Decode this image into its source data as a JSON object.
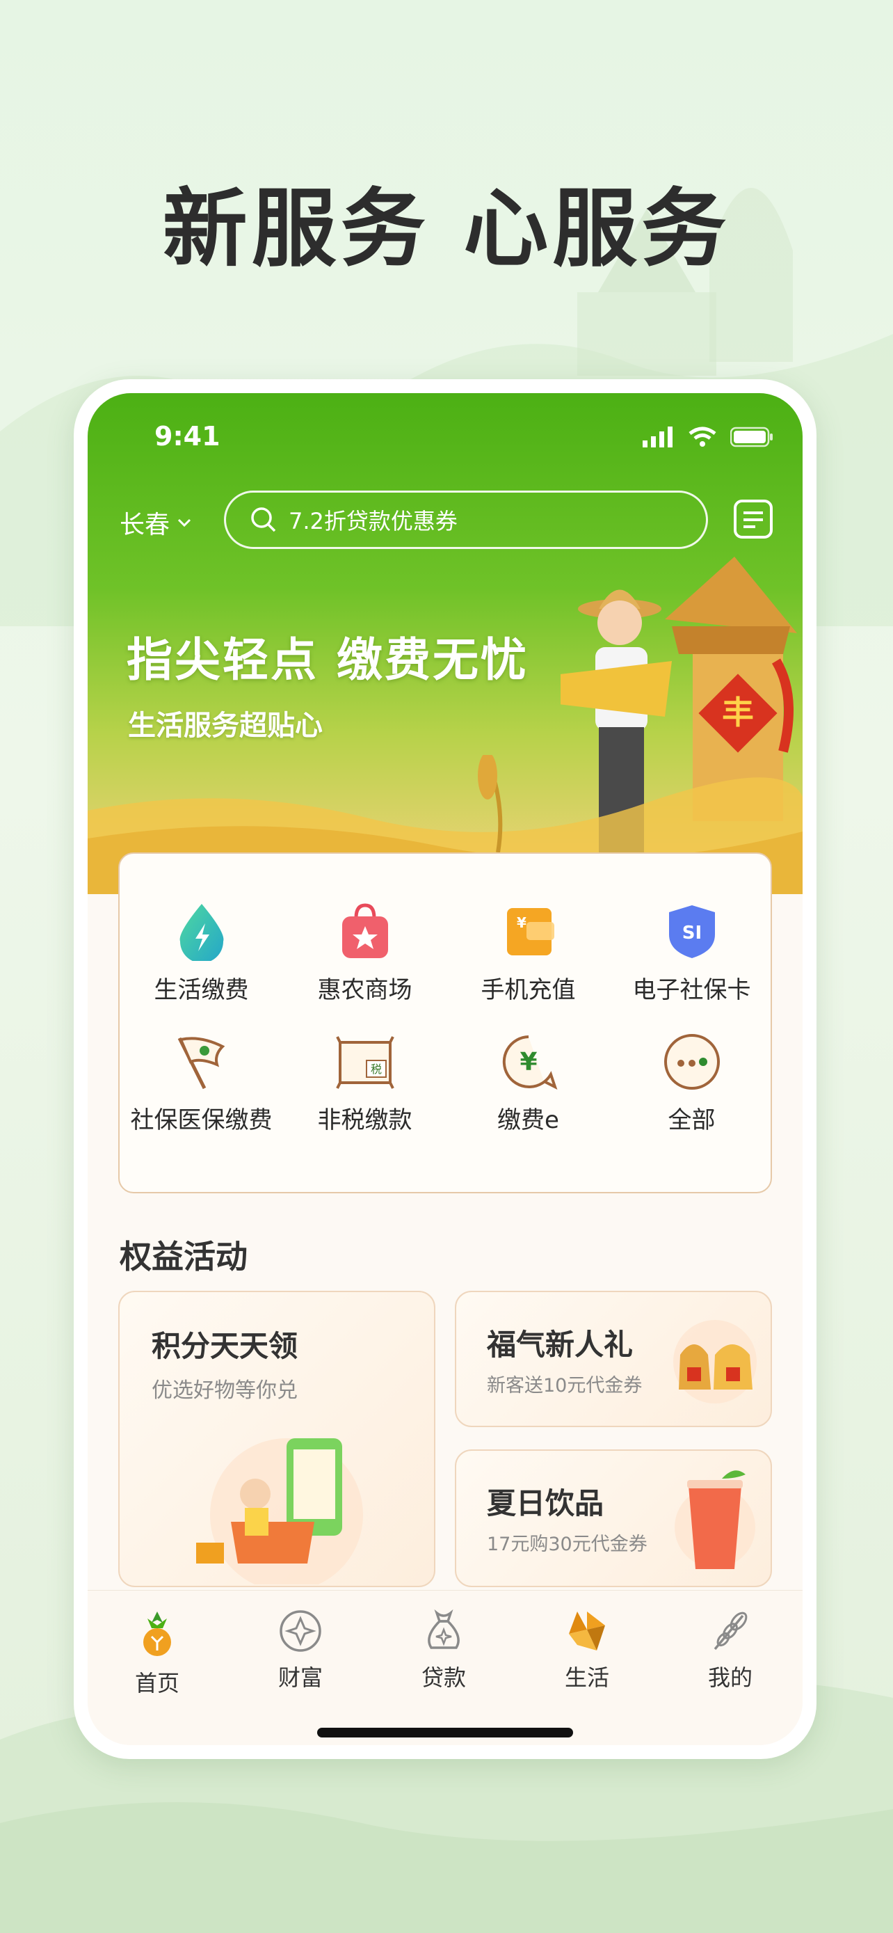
{
  "headline": "新服务 心服务",
  "status_bar": {
    "time": "9:41"
  },
  "top_bar": {
    "city": "长春",
    "search_placeholder": "7.2折贷款优惠券"
  },
  "banner": {
    "title": "指尖轻点 缴费无忧",
    "subtitle": "生活服务超贴心",
    "badge_char": "丰"
  },
  "services": [
    {
      "label": "生活缴费",
      "icon": "water-drop-bolt-icon"
    },
    {
      "label": "惠农商场",
      "icon": "shopping-bag-star-icon"
    },
    {
      "label": "手机充值",
      "icon": "phone-card-icon"
    },
    {
      "label": "电子社保卡",
      "icon": "si-shield-icon"
    },
    {
      "label": "社保医保缴费",
      "icon": "flag-icon"
    },
    {
      "label": "非税缴款",
      "icon": "tax-frame-icon"
    },
    {
      "label": "缴费e",
      "icon": "yen-bubble-icon"
    },
    {
      "label": "全部",
      "icon": "all-dots-icon"
    }
  ],
  "service_icon_text": {
    "tax": "税",
    "si": "SI",
    "yen": "¥"
  },
  "rights_section": {
    "title": "权益活动",
    "cards": [
      {
        "title": "积分天天领",
        "subtitle": "优选好物等你兑"
      },
      {
        "title": "福气新人礼",
        "subtitle": "新客送10元代金券"
      },
      {
        "title": "夏日饮品",
        "subtitle": "17元购30元代金券"
      }
    ]
  },
  "tab_bar": [
    {
      "label": "首页",
      "icon": "home-pineapple-icon",
      "active": false
    },
    {
      "label": "财富",
      "icon": "wealth-diamond-icon",
      "active": false
    },
    {
      "label": "贷款",
      "icon": "loan-bag-icon",
      "active": false
    },
    {
      "label": "生活",
      "icon": "life-diamond-icon",
      "active": true
    },
    {
      "label": "我的",
      "icon": "profile-wheat-icon",
      "active": false
    }
  ],
  "colors": {
    "brand_green": "#4cb014",
    "accent_orange": "#f0a020",
    "card_border": "#e6c9a8"
  }
}
